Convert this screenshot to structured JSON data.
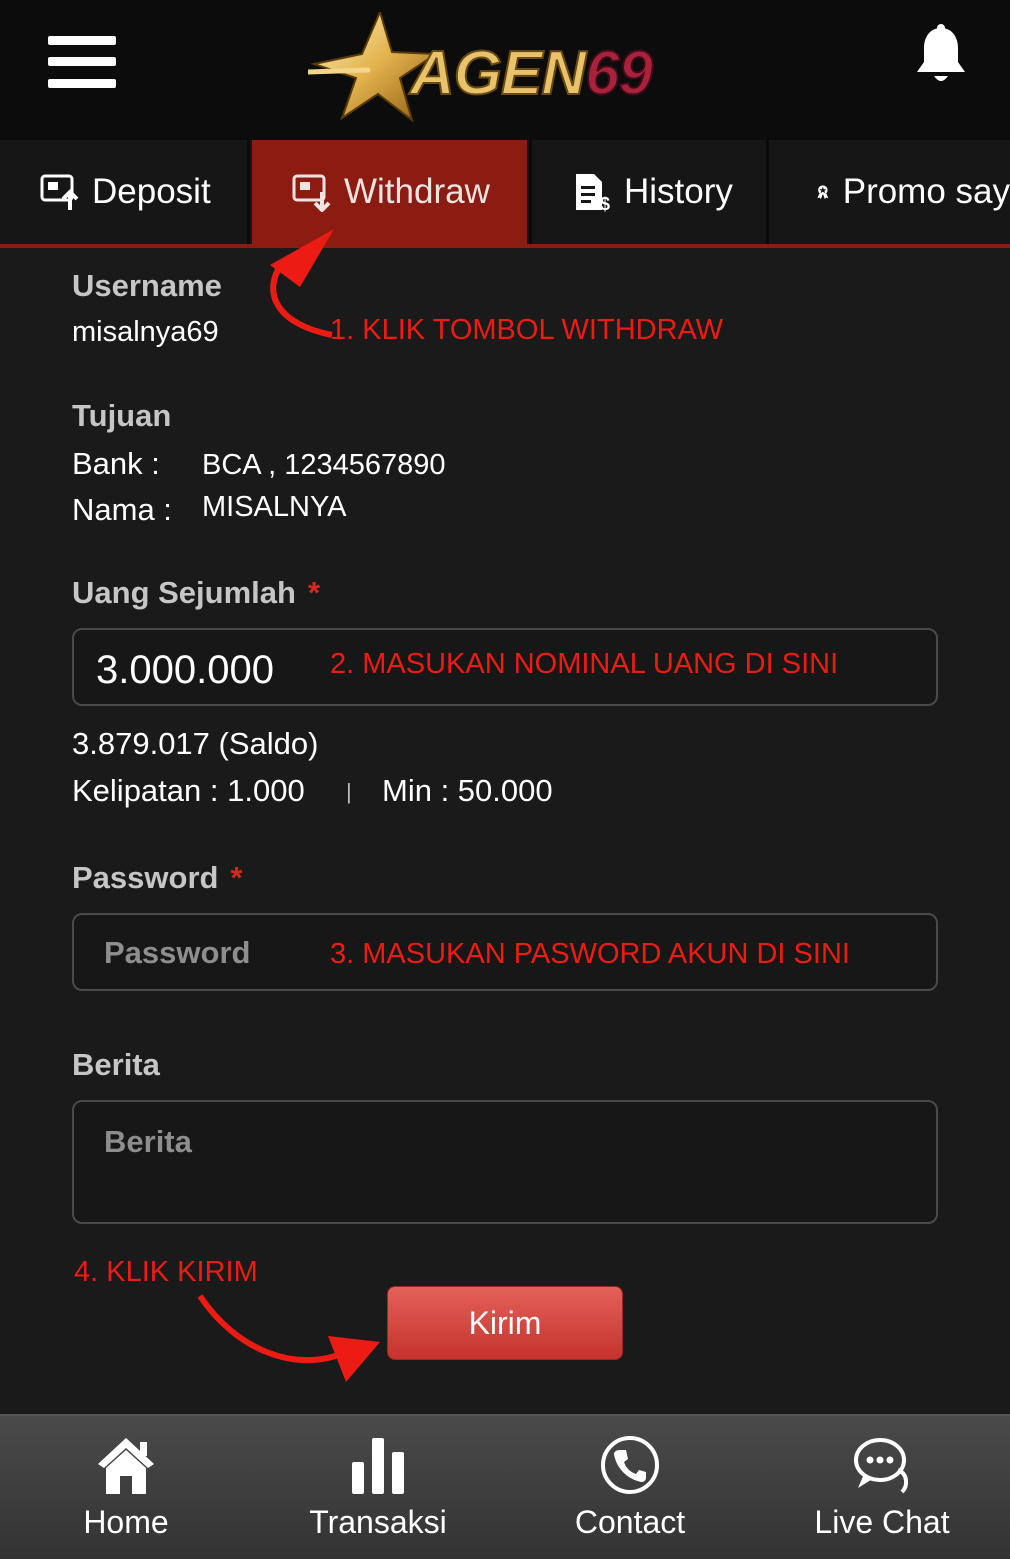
{
  "header": {
    "menu_icon": "hamburger-icon",
    "logo_text_a": "AGEN",
    "logo_text_b": "69",
    "bell_icon": "bell-icon"
  },
  "tabs": [
    {
      "label": "Deposit",
      "icon": "deposit-icon",
      "active": false
    },
    {
      "label": "Withdraw",
      "icon": "withdraw-icon",
      "active": true
    },
    {
      "label": "History",
      "icon": "history-icon",
      "active": false
    },
    {
      "label": "Promo say",
      "icon": "promo-badge-icon",
      "active": false
    }
  ],
  "form": {
    "username_label": "Username",
    "username_value": "misalnya69",
    "tujuan_label": "Tujuan",
    "bank_label": "Bank :",
    "bank_value": "BCA , 1234567890",
    "nama_label": "Nama :",
    "nama_value": "MISALNYA",
    "amount_label": "Uang Sejumlah",
    "required_mark": "*",
    "amount_value": "3.000.000",
    "saldo_text": "3.879.017 (Saldo)",
    "kelipatan_text": "Kelipatan : 1.000",
    "separator": "|",
    "min_text": "Min : 50.000",
    "password_label": "Password",
    "password_placeholder": "Password",
    "berita_label": "Berita",
    "berita_placeholder": "Berita",
    "submit_label": "Kirim"
  },
  "annotations": {
    "step1": "1. KLIK TOMBOL WITHDRAW",
    "step2": "2. MASUKAN NOMINAL UANG DI SINI",
    "step3": "3. MASUKAN PASWORD AKUN DI SINI",
    "step4": "4. KLIK KIRIM"
  },
  "bottom_nav": [
    {
      "label": "Home",
      "icon": "home-icon"
    },
    {
      "label": "Transaksi",
      "icon": "bar-chart-icon"
    },
    {
      "label": "Contact",
      "icon": "phone-icon"
    },
    {
      "label": "Live Chat",
      "icon": "chat-icon"
    }
  ],
  "colors": {
    "accent_red": "#8c1b12",
    "annotation_red": "#ec1c14",
    "button_red": "#d0433d",
    "background": "#1a1a1a"
  }
}
